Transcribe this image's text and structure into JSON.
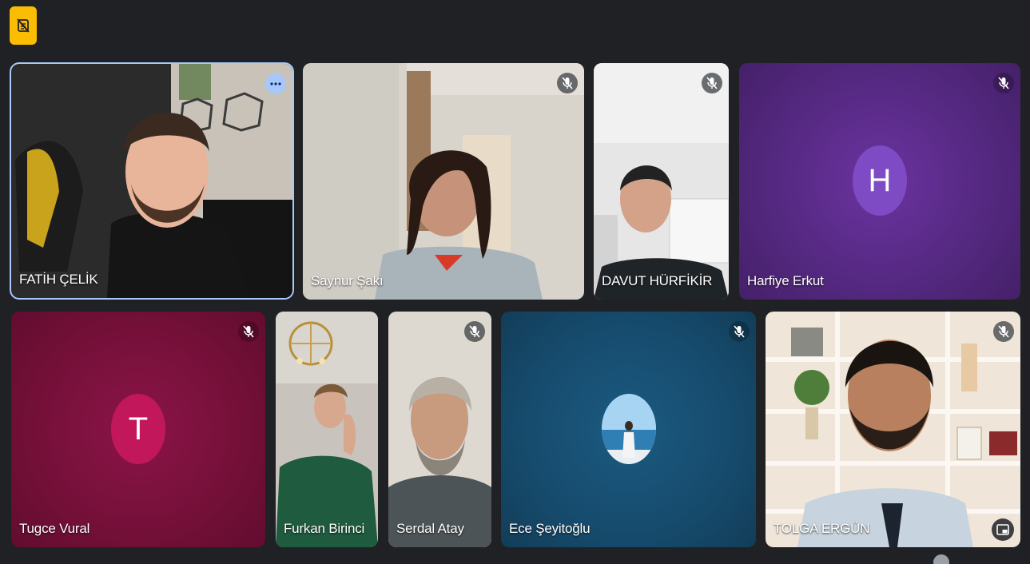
{
  "meeting": {
    "participants": [
      {
        "name": "FATİH ÇELİK",
        "muted": false,
        "pinned": true
      },
      {
        "name": "Saynur Şakı",
        "muted": true
      },
      {
        "name": "DAVUT HÜRFİKİR",
        "muted": true
      },
      {
        "name": "Harfiye Erkut",
        "muted": true,
        "avatar_letter": "H"
      },
      {
        "name": "Tugce Vural",
        "muted": true,
        "avatar_letter": "T"
      },
      {
        "name": "Furkan Birinci",
        "muted": false
      },
      {
        "name": "Serdal Atay",
        "muted": true
      },
      {
        "name": "Ece Şeyitoğlu",
        "muted": true
      },
      {
        "name": "TOLGA ERGÜN",
        "muted": true
      }
    ]
  },
  "icons": {
    "top_badge": "hand-off-icon",
    "more": "more-options-icon",
    "mic": "mic-off-icon",
    "pip": "picture-in-picture-icon"
  },
  "colors": {
    "background": "#202124",
    "active_outline": "#a8c7fa",
    "badge": "#fbbc04",
    "harfiye_tile": "#5a2a8a",
    "harfiye_avatar": "#7e4bc4",
    "tugce_tile": "#7a1040",
    "tugce_avatar": "#c2185b",
    "ece_tile": "#15456a"
  }
}
